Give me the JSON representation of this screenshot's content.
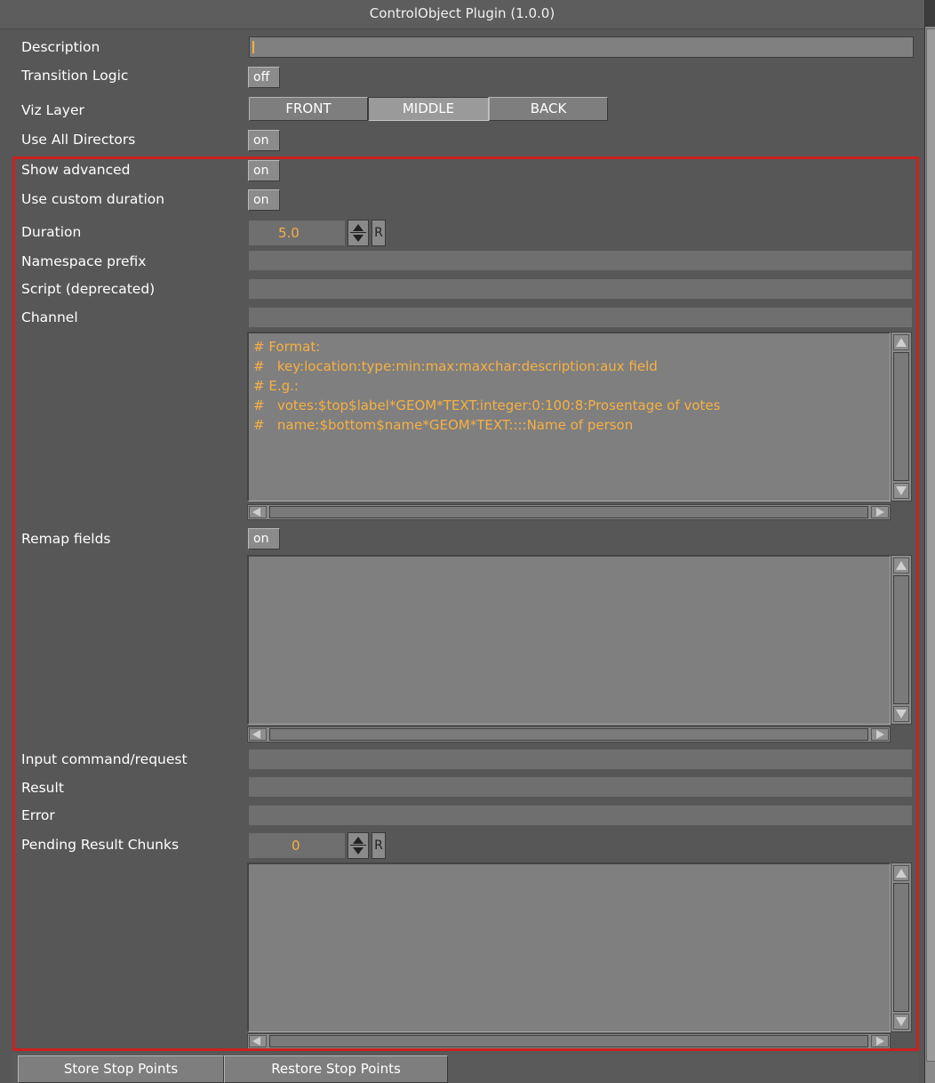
{
  "window": {
    "title": "ControlObject Plugin (1.0.0)"
  },
  "colors": {
    "panel": "#575757",
    "accent_text": "#f7b042",
    "highlight_border": "#cc2020"
  },
  "fields": {
    "description": {
      "label": "Description",
      "value": ""
    },
    "transition_logic": {
      "label": "Transition Logic",
      "value": "off"
    },
    "viz_layer": {
      "label": "Viz Layer",
      "options": [
        "FRONT",
        "MIDDLE",
        "BACK"
      ],
      "selected": "MIDDLE"
    },
    "use_all_directors": {
      "label": "Use All Directors",
      "value": "on"
    },
    "show_advanced": {
      "label": "Show advanced",
      "value": "on"
    },
    "use_custom_duration": {
      "label": "Use custom duration",
      "value": "on"
    },
    "duration": {
      "label": "Duration",
      "value": "5.0",
      "reset": "R"
    },
    "namespace_prefix": {
      "label": "Namespace prefix",
      "value": ""
    },
    "script": {
      "label": "Script (deprecated)",
      "value": ""
    },
    "channel": {
      "label": "Channel",
      "value": ""
    },
    "format_text": {
      "lines": [
        "# Format:",
        "#   key:location:type:min:max:maxchar:description:aux field",
        "# E.g.:",
        "#   votes:$top$label*GEOM*TEXT:integer:0:100:8:Prosentage of votes",
        "#   name:$bottom$name*GEOM*TEXT::::Name of person"
      ]
    },
    "remap_fields": {
      "label": "Remap fields",
      "value": "on"
    },
    "input_command": {
      "label": "Input command/request",
      "value": ""
    },
    "result": {
      "label": "Result",
      "value": ""
    },
    "error": {
      "label": "Error",
      "value": ""
    },
    "pending_result_chunks": {
      "label": "Pending Result Chunks",
      "value": "0",
      "reset": "R"
    }
  },
  "bottom_buttons": {
    "store": "Store Stop Points",
    "restore": "Restore Stop Points"
  }
}
